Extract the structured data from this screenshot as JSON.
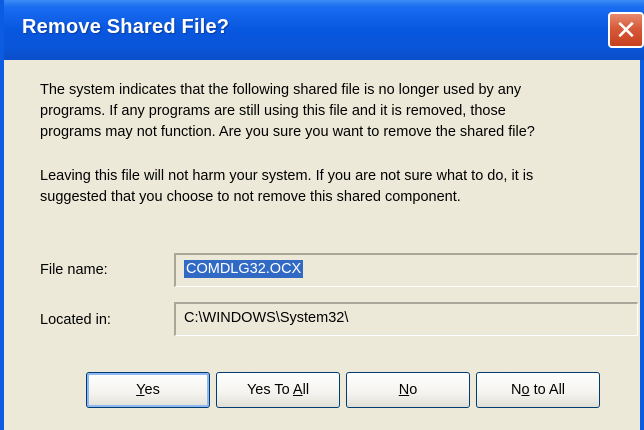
{
  "window": {
    "title": "Remove Shared File?"
  },
  "message": {
    "paragraph1_line1": "The system indicates that the following shared file is no longer used by any",
    "paragraph1_line2": "programs.  If any programs are still using this file and it is removed, those",
    "paragraph1_line3": "programs may not function.  Are you sure you want to remove the shared file?",
    "paragraph2_line1": "Leaving this file will not harm your system.  If you are not sure what to do, it is",
    "paragraph2_line2": "suggested that you choose to not remove this shared component."
  },
  "fields": {
    "file_name_label": "File name:",
    "file_name_value": "COMDLG32.OCX",
    "located_in_label": "Located in:",
    "located_in_value": "C:\\WINDOWS\\System32\\"
  },
  "buttons": {
    "yes": {
      "pre": "",
      "accel": "Y",
      "post": "es"
    },
    "yes_to_all": {
      "pre": "Yes To ",
      "accel": "A",
      "post": "ll"
    },
    "no": {
      "pre": "",
      "accel": "N",
      "post": "o"
    },
    "no_to_all": {
      "pre": "N",
      "accel": "o",
      "post": " to All"
    }
  },
  "colors": {
    "titlebar": "#0a55d8",
    "dialog_bg": "#ece9d8",
    "selection": "#316ac5",
    "close_button": "#d65a39"
  },
  "icons": {
    "close": "close-icon"
  }
}
